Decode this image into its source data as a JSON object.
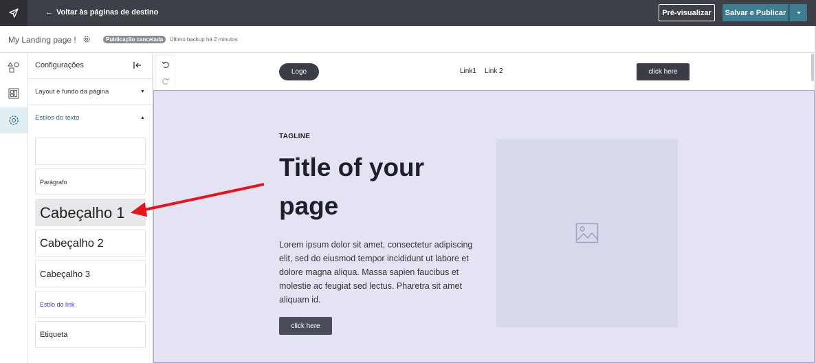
{
  "topbar": {
    "back_label": "Voltar às páginas de destino",
    "preview_label": "Pré-visualizar",
    "publish_label": "Salvar e Publicar",
    "logo_icon": "paper-plane-icon"
  },
  "subbar": {
    "page_name": "My Landing page !",
    "status_badge": "Publicação cancelada",
    "backup_text": "Último backup há 2 minutos"
  },
  "rail": {
    "items": [
      "shapes-icon",
      "layout-icon",
      "gear-icon"
    ],
    "active_index": 2
  },
  "panel": {
    "title": "Configurações",
    "sections": [
      {
        "label": "Layout e fundo da página",
        "expanded": false
      },
      {
        "label": "Estilos do texto",
        "expanded": true
      }
    ],
    "text_styles": [
      {
        "label": ""
      },
      {
        "label": "Parágrafo"
      },
      {
        "label": "Cabeçalho 1"
      },
      {
        "label": "Cabeçalho 2"
      },
      {
        "label": "Cabeçalho 3"
      },
      {
        "label": "Estilo do link"
      },
      {
        "label": "Etiqueta"
      }
    ]
  },
  "site": {
    "logo": "Logo",
    "link1": "Link1",
    "link2": "Link 2",
    "nav_button": "click here",
    "tagline": "TAGLINE",
    "title": "Title of your page",
    "body": "Lorem ipsum dolor sit amet, consectetur adipiscing elit, sed do eiusmod tempor incididunt ut labore et dolore magna aliqua. Massa sapien faucibus et molestie ac feugiat sed lectus. Pharetra sit amet aliquam id.",
    "hero_button": "click here"
  },
  "colors": {
    "topbar": "#3d4046",
    "accent": "#3d7d92",
    "hero_bg": "#e3e3f4",
    "annotation_arrow": "#e8141c"
  }
}
